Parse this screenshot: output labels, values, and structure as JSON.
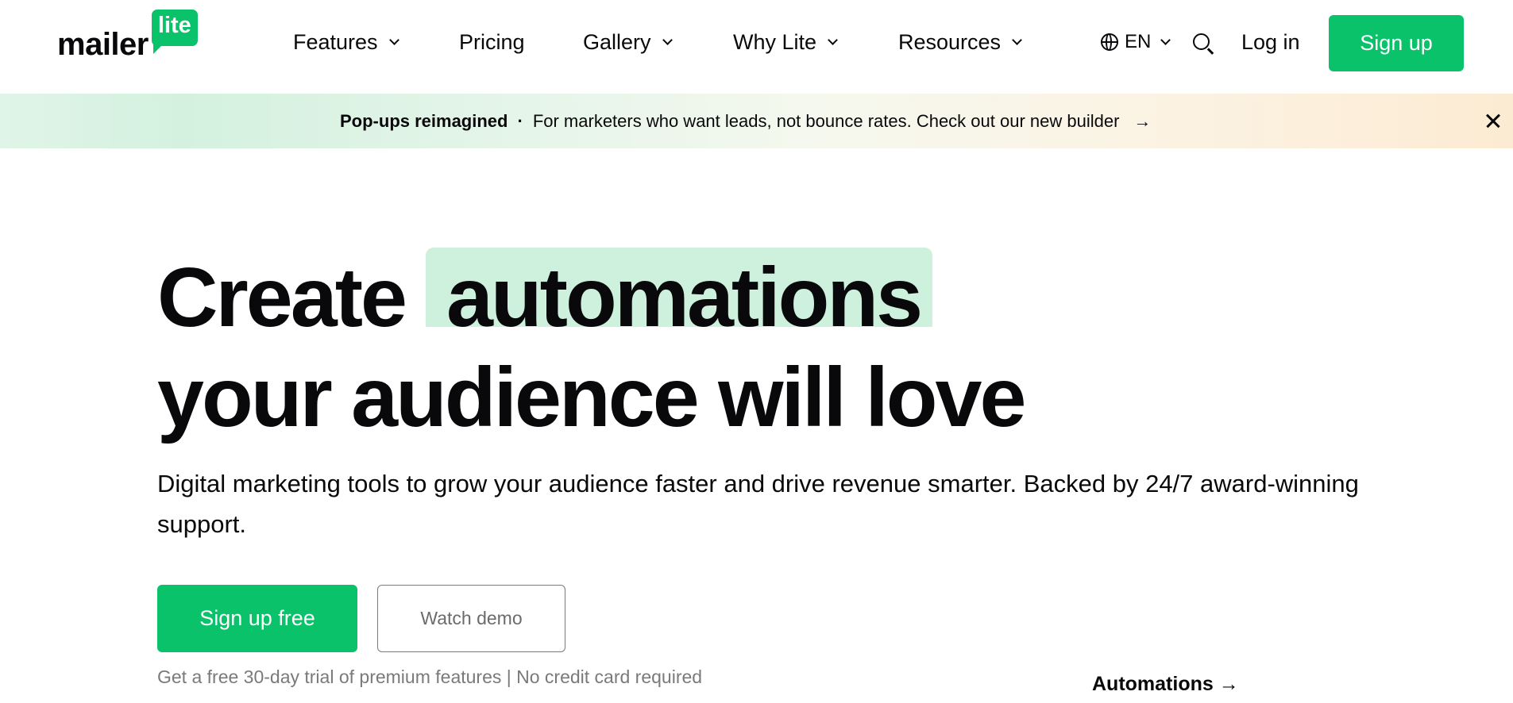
{
  "header": {
    "logo": {
      "word": "mailer",
      "badge": "lite"
    },
    "nav": [
      {
        "label": "Features",
        "dropdown": true
      },
      {
        "label": "Pricing",
        "dropdown": false
      },
      {
        "label": "Gallery",
        "dropdown": true
      },
      {
        "label": "Why Lite",
        "dropdown": true
      },
      {
        "label": "Resources",
        "dropdown": true
      }
    ],
    "language": "EN",
    "login_label": "Log in",
    "signup_label": "Sign up"
  },
  "banner": {
    "title": "Pop-ups reimagined",
    "separator": "·",
    "message": "For marketers who want leads, not bounce rates. Check out our new builder",
    "arrow": "→"
  },
  "hero": {
    "title_start": "Create",
    "title_highlight": "automations",
    "title_end": "your audience will love",
    "subtitle": "Digital marketing tools to grow your audience faster and drive revenue smarter. Backed by 24/7 award-winning support.",
    "primary_cta": "Sign up free",
    "secondary_cta": "Watch demo",
    "note": "Get a free 30-day trial of premium features | No credit card required",
    "feature_link": "Automations →"
  },
  "colors": {
    "brand_green": "#09c269",
    "highlight": "#cdf1dc",
    "text": "#09090b"
  }
}
